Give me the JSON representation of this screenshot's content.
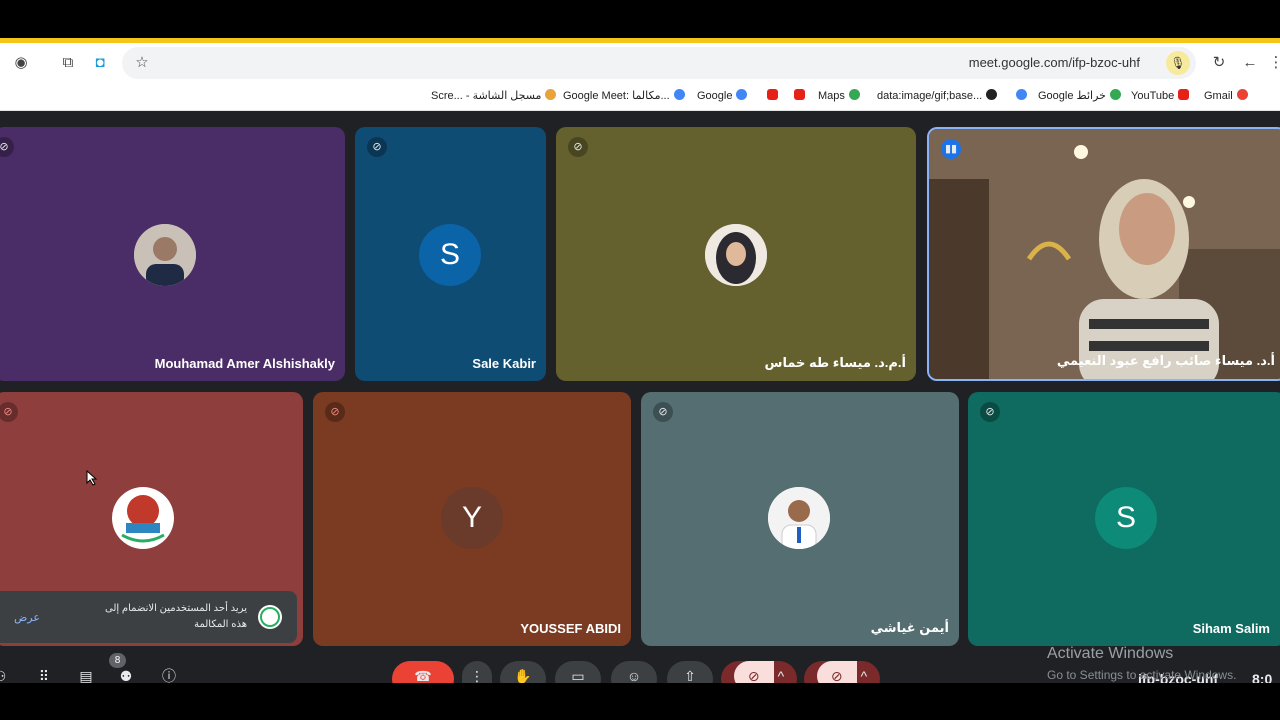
{
  "browser": {
    "url": "meet.google.com/ifp-bzoc-uhf",
    "bookmarks": [
      {
        "label": "Scre... - مسجل الشاشة"
      },
      {
        "label": "Google Meet: مكالما..."
      },
      {
        "label": "Google"
      },
      {
        "label": "Maps"
      },
      {
        "label": "data:image/gif;base..."
      },
      {
        "label": "Google خرائط"
      },
      {
        "label": "YouTube"
      },
      {
        "label": "Gmail"
      }
    ]
  },
  "participants": {
    "row1": [
      {
        "name": "Mouhamad Amer Alshishakly",
        "bg": "#4a2d66"
      },
      {
        "name": "Sale Kabir",
        "bg": "#0e4c73",
        "initial": "S",
        "avatar_bg": "#0b63a8"
      },
      {
        "name": "أ.م.د. ميساء طه خماس",
        "bg": "#65612f"
      },
      {
        "name": "أ.د. ميساء صائب رافع عبود النعيمي",
        "bg": "#6a5848"
      }
    ],
    "row2": [
      {
        "name": "",
        "bg": "#8e3f3d"
      },
      {
        "name": "YOUSSEF ABIDI",
        "bg": "#7a3b22",
        "initial": "Y",
        "avatar_bg": "#6a3a2a"
      },
      {
        "name": "أيمن غياشي",
        "bg": "#546e72"
      },
      {
        "name": "Siham Salim",
        "bg": "#0f6a5f",
        "initial": "S",
        "avatar_bg": "#0e8a78"
      }
    ]
  },
  "toast": {
    "message": "يريد أحد المستخدمين الانضمام إلى هذه المكالمة",
    "action": "عرض"
  },
  "controls": {
    "people_count": "8",
    "meeting_code": "ifp-bzoc-uhf",
    "time": "8:0"
  },
  "watermark": {
    "title": "Activate Windows",
    "subtitle": "Go to Settings to activate Windows."
  },
  "colors": {
    "stripe": "#f5c518",
    "end_call": "#ea4335",
    "muted_red": "#f28b82"
  }
}
